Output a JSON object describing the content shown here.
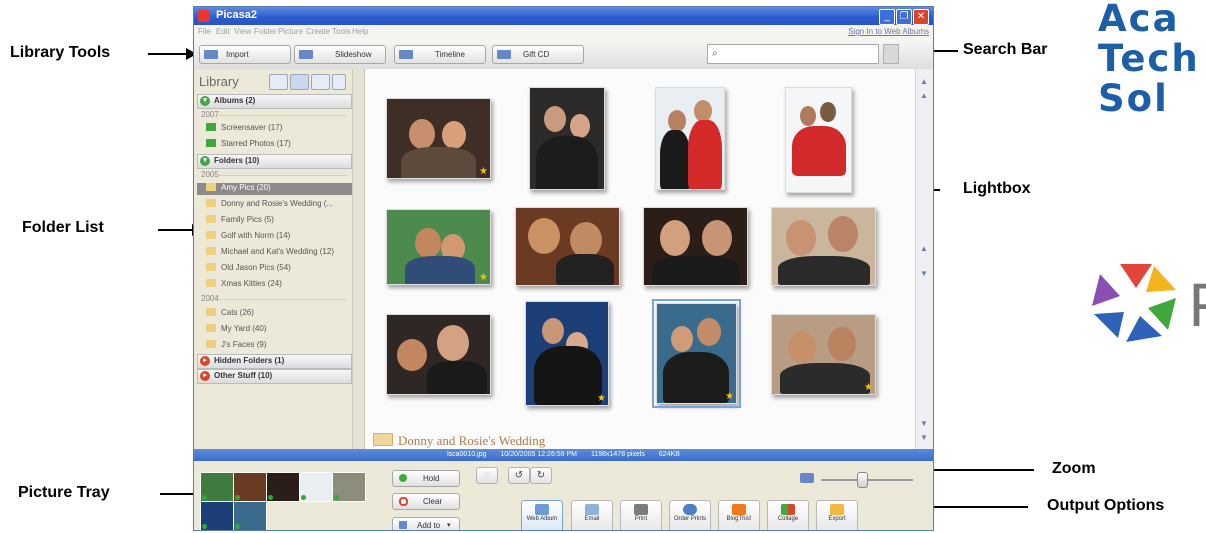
{
  "callouts": {
    "library_tools": "Library Tools",
    "search_bar": "Search Bar",
    "lightbox": "Lightbox",
    "folder_list": "Folder List",
    "zoom": "Zoom",
    "picture_tray": "Picture Tray",
    "output_options": "Output Options"
  },
  "branding": {
    "line1": "Aca",
    "line2": "Tech",
    "line3": "Sol",
    "logo_letter": "P",
    "colors": {
      "blue": "#1d5ea8",
      "purple": "#8a4fb3",
      "red": "#e4453a",
      "yellow": "#f4b21b",
      "green": "#3faa3b",
      "darkblue": "#2e62b8"
    }
  },
  "window": {
    "title": "Picasa2",
    "sign_in": "Sign In to Web Albums",
    "menu": [
      "File",
      "Edit",
      "View",
      "Folder",
      "Picture",
      "Create",
      "Tools",
      "Help"
    ]
  },
  "toolbar": {
    "import_label": "Import",
    "slideshow_label": "Slideshow",
    "timeline_label": "Timeline",
    "giftcd_label": "Gift CD",
    "search_placeholder": ""
  },
  "library": {
    "heading": "Library",
    "sections": {
      "albums": "Albums (2)",
      "folders": "Folders (10)",
      "hidden": "Hidden Folders (1)",
      "other": "Other Stuff (10)"
    },
    "albums_year": "2007",
    "albums": [
      "Screensaver (17)",
      "Starred Photos (17)"
    ],
    "years": {
      "y2005": "2005",
      "y2004": "2004"
    },
    "folders_2005": [
      "Amy Pics (20)",
      "Donny and Rosie's Wedding (...",
      "Family Pics (5)",
      "Golf with Norm (14)",
      "Michael and Kat's Wedding (12)",
      "Old Jason Pics (54)",
      "Xmas Kitties (24)"
    ],
    "folders_2004": [
      "Cats (26)",
      "My Yard (40)",
      "J's Faces (9)"
    ],
    "selected_folder": "Amy Pics (20)"
  },
  "lightbox": {
    "folder_title": "Donny and Rosie's Wedding",
    "photo_count": 12,
    "starred_photos": [
      1,
      5,
      10,
      12
    ],
    "selected_photo": 11
  },
  "status": {
    "filename": "lsca0010.jpg",
    "datetime": "10/20/2005 12:26:59 PM",
    "dimensions": "1198x1478 pixels",
    "size": "624KB"
  },
  "tray": {
    "hold_label": "Hold",
    "clear_label": "Clear",
    "addto_label": "Add to",
    "thumbnail_count": 7
  },
  "output": {
    "web_album": "Web Album",
    "email": "Email",
    "print": "Print",
    "order_prints": "Order Prints",
    "blogthis": "BlogThis!",
    "collage": "Collage",
    "export": "Export"
  },
  "zoom": {
    "level": 0.45
  }
}
